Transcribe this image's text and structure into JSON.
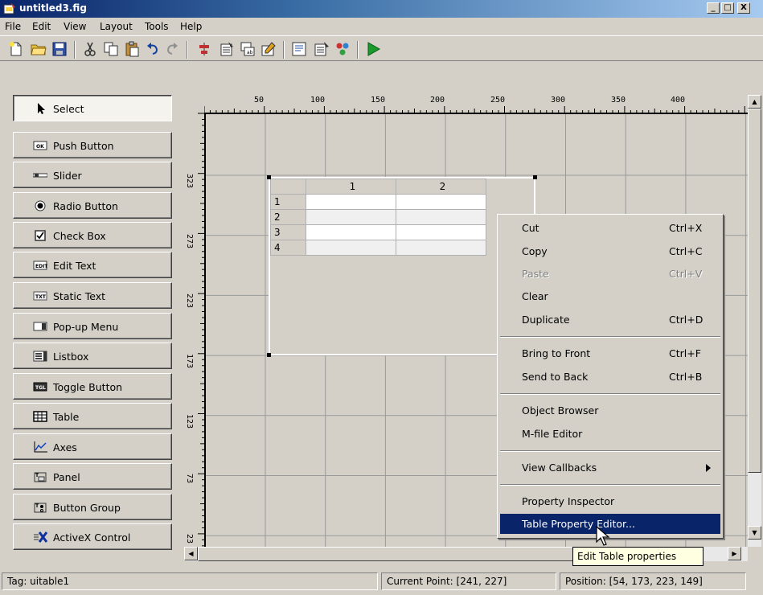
{
  "window": {
    "title": "untitled3.fig",
    "min_label": "_",
    "max_label": "□",
    "close_label": "X"
  },
  "menu": [
    "File",
    "Edit",
    "View",
    "Layout",
    "Tools",
    "Help"
  ],
  "palette": [
    {
      "label": "Select",
      "icon": "arrow-cursor-icon",
      "selected": true
    },
    {
      "label": "Push Button",
      "icon": "push-button-icon"
    },
    {
      "label": "Slider",
      "icon": "slider-icon"
    },
    {
      "label": "Radio Button",
      "icon": "radio-button-icon"
    },
    {
      "label": "Check Box",
      "icon": "check-box-icon"
    },
    {
      "label": "Edit Text",
      "icon": "edit-text-icon"
    },
    {
      "label": "Static Text",
      "icon": "static-text-icon"
    },
    {
      "label": "Pop-up Menu",
      "icon": "popup-menu-icon"
    },
    {
      "label": "Listbox",
      "icon": "listbox-icon"
    },
    {
      "label": "Toggle Button",
      "icon": "toggle-button-icon"
    },
    {
      "label": "Table",
      "icon": "table-icon"
    },
    {
      "label": "Axes",
      "icon": "axes-icon"
    },
    {
      "label": "Panel",
      "icon": "panel-icon"
    },
    {
      "label": "Button Group",
      "icon": "button-group-icon"
    },
    {
      "label": "ActiveX Control",
      "icon": "activex-icon"
    }
  ],
  "ruler": {
    "top": [
      "50",
      "100",
      "150",
      "200",
      "250",
      "300",
      "350",
      "400"
    ],
    "left": [
      "323",
      "273",
      "223",
      "173",
      "123",
      "73",
      "23"
    ]
  },
  "table": {
    "columns": [
      "1",
      "2"
    ],
    "rows": [
      "1",
      "2",
      "3",
      "4"
    ]
  },
  "context_menu": [
    {
      "type": "item",
      "label": "Cut",
      "shortcut": "Ctrl+X"
    },
    {
      "type": "item",
      "label": "Copy",
      "shortcut": "Ctrl+C"
    },
    {
      "type": "item",
      "label": "Paste",
      "shortcut": "Ctrl+V",
      "disabled": true
    },
    {
      "type": "item",
      "label": "Clear",
      "shortcut": ""
    },
    {
      "type": "item",
      "label": "Duplicate",
      "shortcut": "Ctrl+D"
    },
    {
      "type": "sep"
    },
    {
      "type": "item",
      "label": "Bring to Front",
      "shortcut": "Ctrl+F"
    },
    {
      "type": "item",
      "label": "Send to Back",
      "shortcut": "Ctrl+B"
    },
    {
      "type": "sep"
    },
    {
      "type": "item",
      "label": "Object Browser",
      "shortcut": ""
    },
    {
      "type": "item",
      "label": "M-file Editor",
      "shortcut": ""
    },
    {
      "type": "sep"
    },
    {
      "type": "item",
      "label": "View Callbacks",
      "shortcut": "",
      "submenu": true
    },
    {
      "type": "sep"
    },
    {
      "type": "item",
      "label": "Property Inspector",
      "shortcut": ""
    },
    {
      "type": "item",
      "label": "Table Property Editor...",
      "shortcut": "",
      "highlighted": true
    }
  ],
  "tooltip": "Edit Table properties",
  "status": {
    "tag": "Tag: uitable1",
    "current_point": "Current Point:  [241, 227]",
    "position": "Position: [54, 173, 223, 149]"
  },
  "colors": {
    "highlight": "#0a246a",
    "titlebar": "#0a246a",
    "face": "#d4d0c8",
    "run_green": "#1a9a2a"
  }
}
